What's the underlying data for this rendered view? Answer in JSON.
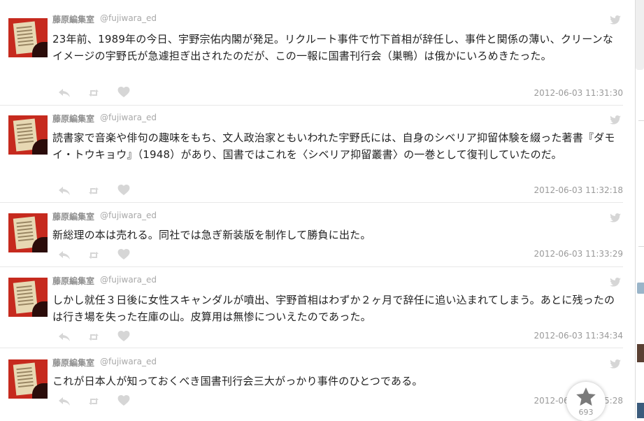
{
  "tweets": [
    {
      "name": "藤原編集室",
      "handle": "@fujiwara_ed",
      "text": "23年前、1989年の今日、宇野宗佑内閣が発足。リクルート事件で竹下首相が辞任し、事件と関係の薄い、クリーンなイメージの宇野氏が急遽担ぎ出されたのだが、この一報に国書刊行会（巣鴨）は俄かにいろめきたった。",
      "timestamp": "2012-06-03 11:31:30"
    },
    {
      "name": "藤原編集室",
      "handle": "@fujiwara_ed",
      "text": "読書家で音楽や俳句の趣味をもち、文人政治家ともいわれた宇野氏には、自身のシベリア抑留体験を綴った著書『ダモイ・トウキョウ』（1948）があり、国書ではこれを〈シベリア抑留叢書〉の一巻として復刊していたのだ。",
      "timestamp": "2012-06-03 11:32:18"
    },
    {
      "name": "藤原編集室",
      "handle": "@fujiwara_ed",
      "text": "新総理の本は売れる。同社では急ぎ新装版を制作して勝負に出た。",
      "timestamp": "2012-06-03 11:33:29"
    },
    {
      "name": "藤原編集室",
      "handle": "@fujiwara_ed",
      "text": "しかし就任３日後に女性スキャンダルが噴出、宇野首相はわずか２ヶ月で辞任に追い込まれてしまう。あとに残ったのは行き場を失った在庫の山。皮算用は無惨についえたのであった。",
      "timestamp": "2012-06-03 11:34:34"
    },
    {
      "name": "藤原編集室",
      "handle": "@fujiwara_ed",
      "text": "これが日本人が知っておくべき国書刊行会三大がっかり事件のひとつである。",
      "timestamp": "2012-06-03 11:35:28"
    }
  ],
  "favorite_count": "693",
  "colors": {
    "icon": "#d6d6d6",
    "star": "#7a7a7a",
    "accent": "#c62a1e"
  }
}
